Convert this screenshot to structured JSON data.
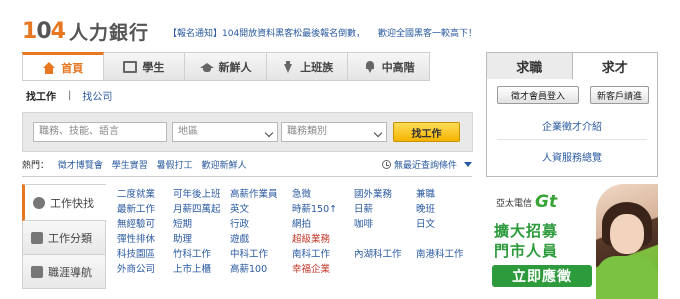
{
  "header": {
    "logo_number": "104",
    "logo_text": "人力銀行",
    "notice": "【報名通知】104開放資料黑客松最後報名倒數，",
    "notice_link": "歡迎全國黑客一較高下！"
  },
  "main_tabs": [
    {
      "label": "首頁",
      "icon": "home-icon"
    },
    {
      "label": "學生",
      "icon": "book-icon"
    },
    {
      "label": "新鮮人",
      "icon": "graduation-cap-icon"
    },
    {
      "label": "上班族",
      "icon": "tie-icon"
    },
    {
      "label": "中高階",
      "icon": "fountain-pen-icon"
    }
  ],
  "subtabs": {
    "active": "找工作",
    "separator": "|",
    "other": "找公司"
  },
  "search": {
    "keyword_placeholder": "職務、技能、語言",
    "area_placeholder": "地區",
    "category_placeholder": "職務類別",
    "button": "找工作"
  },
  "hot": {
    "label": "熱門：",
    "links": [
      "徵才博覽會",
      "學生實習",
      "暑假打工",
      "歡迎新鮮人"
    ],
    "condition": "無最近查詢條件"
  },
  "left_nav": [
    {
      "label": "工作快找",
      "icon": "search-circle-icon"
    },
    {
      "label": "工作分類",
      "icon": "category-icon"
    },
    {
      "label": "職涯導航",
      "icon": "navigation-icon"
    }
  ],
  "quick_links": [
    {
      "label": "二度就業",
      "red": false
    },
    {
      "label": "可年後上班",
      "red": false
    },
    {
      "label": "高薪作業員",
      "red": false
    },
    {
      "label": "急徵",
      "red": false
    },
    {
      "label": "國外業務",
      "red": false
    },
    {
      "label": "兼職",
      "red": false
    },
    {
      "label": "最新工作",
      "red": false
    },
    {
      "label": "月薪四萬起",
      "red": false
    },
    {
      "label": "英文",
      "red": false
    },
    {
      "label": "時薪150↑",
      "red": false
    },
    {
      "label": "日薪",
      "red": false
    },
    {
      "label": "晚班",
      "red": false
    },
    {
      "label": "無經驗可",
      "red": false
    },
    {
      "label": "短期",
      "red": false
    },
    {
      "label": "行政",
      "red": false
    },
    {
      "label": "網拍",
      "red": false
    },
    {
      "label": "咖啡",
      "red": false
    },
    {
      "label": "日文",
      "red": false
    },
    {
      "label": "彈性排休",
      "red": false
    },
    {
      "label": "助理",
      "red": false
    },
    {
      "label": "遊戲",
      "red": false
    },
    {
      "label": "超級業務",
      "red": true
    },
    {
      "label": "",
      "red": false
    },
    {
      "label": "",
      "red": false
    },
    {
      "label": "科技園區",
      "red": false
    },
    {
      "label": "竹科工作",
      "red": false
    },
    {
      "label": "中科工作",
      "red": false
    },
    {
      "label": "南科工作",
      "red": false
    },
    {
      "label": "內湖科工作",
      "red": false
    },
    {
      "label": "南港科工作",
      "red": false
    },
    {
      "label": "外商公司",
      "red": false
    },
    {
      "label": "上市上櫃",
      "red": false
    },
    {
      "label": "高薪100",
      "red": false
    },
    {
      "label": "幸福企業",
      "red": true
    },
    {
      "label": "",
      "red": false
    },
    {
      "label": "",
      "red": false
    }
  ],
  "right_panel": {
    "tabs": [
      "求職",
      "求才"
    ],
    "login_button": "徵才會員登入",
    "signup_button": "新客戶請進",
    "link1": "企業徵才介紹",
    "link2": "人資服務總覽"
  },
  "ad": {
    "brand": "亞太電信",
    "brand_logo": "Gt",
    "line1": "擴大招募",
    "line2": "門市人員",
    "cta": "立即應徵",
    "accent_color": "#2d9a3c"
  },
  "colors": {
    "brand_orange": "#e87722",
    "link_blue": "#2a5aa0",
    "hot_red": "#c0392b"
  }
}
